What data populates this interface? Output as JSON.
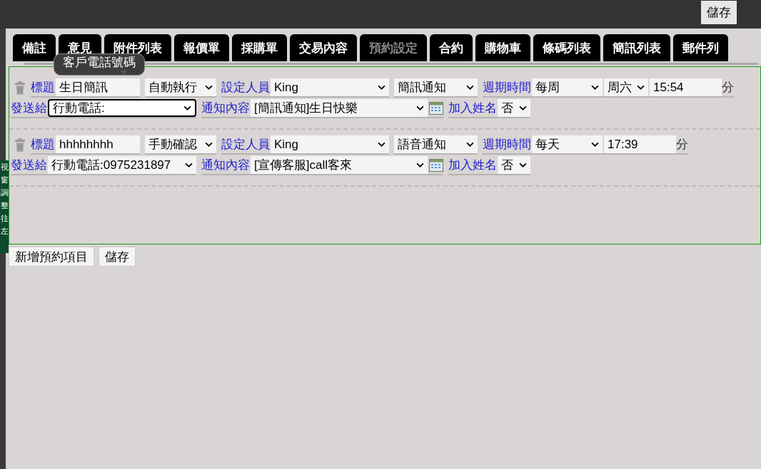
{
  "top_bar": {
    "save_button": "儲存"
  },
  "side_handle": {
    "label": "視窗調整往左"
  },
  "tabs": [
    {
      "label": "備註",
      "selected": false
    },
    {
      "label": "意見",
      "selected": false
    },
    {
      "label": "附件列表",
      "selected": false
    },
    {
      "label": "報價單",
      "selected": false
    },
    {
      "label": "採購單",
      "selected": false
    },
    {
      "label": "交易內容",
      "selected": false
    },
    {
      "label": "預約設定",
      "selected": true
    },
    {
      "label": "合約",
      "selected": false
    },
    {
      "label": "購物車",
      "selected": false
    },
    {
      "label": "條碼列表",
      "selected": false
    },
    {
      "label": "簡訊列表",
      "selected": false
    },
    {
      "label": "郵件列",
      "selected": false
    }
  ],
  "schedules": [
    {
      "title_label": "標題",
      "title": "生日簡訊",
      "mode": "自動執行",
      "staff_label": "設定人員",
      "staff": "King",
      "channel": "簡訊通知",
      "period_label": "週期時間",
      "period": "每周",
      "weekday": "周六",
      "time": "15:54",
      "minute_unit": "分",
      "send_to_label": "發送給",
      "send_to": "行動電話:",
      "focused": true,
      "content_label": "通知內容",
      "content": "[簡訊通知]生日快樂",
      "add_name_label": "加入姓名",
      "add_name": "否"
    },
    {
      "title_label": "標題",
      "title": "hhhhhhhh",
      "mode": "手動確認",
      "staff_label": "設定人員",
      "staff": "King",
      "channel": "語音通知",
      "period_label": "週期時間",
      "period": "每天",
      "time": "17:39",
      "minute_unit": "分",
      "send_to_label": "發送給",
      "send_to": "行動電話:0975231897",
      "focused": false,
      "content_label": "通知內容",
      "content": "[宣傳客服]call客來",
      "add_name_label": "加入姓名",
      "add_name": "否"
    }
  ],
  "tooltip": {
    "text": "客戶電話號碼"
  },
  "buttons": [
    "新增預約項目",
    "儲存"
  ]
}
